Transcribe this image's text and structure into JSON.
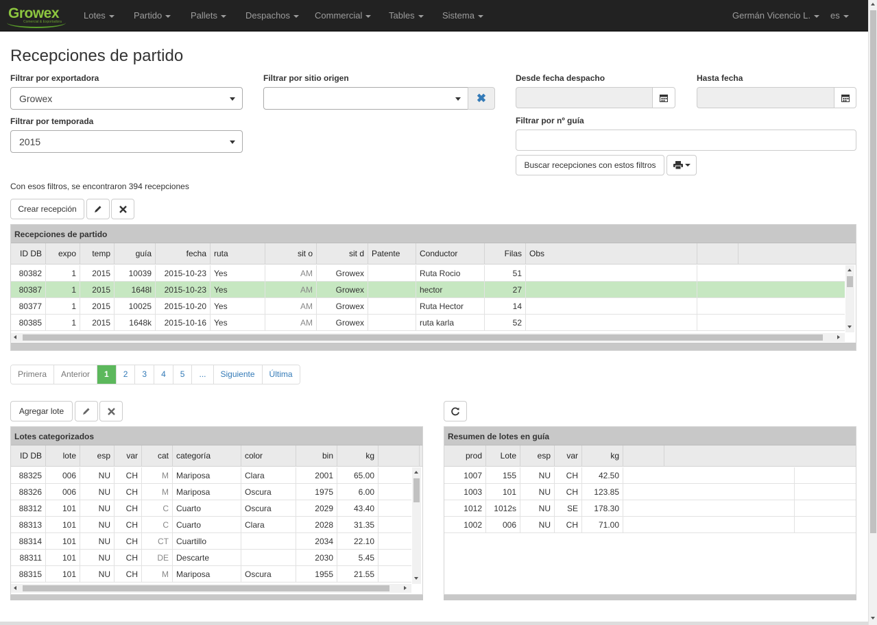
{
  "nav": {
    "brand": "Growex",
    "brand_sub": "Comercial & Exportadora",
    "menu": [
      "Lotes",
      "Partido",
      "Pallets",
      "Despachos",
      "Commercial",
      "Tables",
      "Sistema"
    ],
    "user": "Germán Vicencio L.",
    "lang": "es"
  },
  "page": {
    "title": "Recepciones de partido"
  },
  "filters": {
    "exportadora_label": "Filtrar por exportadora",
    "exportadora_value": "Growex",
    "sitio_label": "Filtrar por sitio origen",
    "sitio_value": "",
    "desde_label": "Desde fecha despacho",
    "hasta_label": "Hasta fecha",
    "temporada_label": "Filtrar por temporada",
    "temporada_value": "2015",
    "guia_label": "Filtrar por nº guía",
    "search_button": "Buscar recepciones con estos filtros"
  },
  "info": "Con esos filtros, se encontraron 394 recepciones",
  "actions": {
    "create": "Crear recepción"
  },
  "receptions": {
    "title": "Recepciones de partido",
    "columns": [
      "ID DB",
      "expo",
      "temp",
      "guía",
      "fecha",
      "ruta",
      "sit o",
      "sit d",
      "Patente",
      "Conductor",
      "Filas",
      "Obs"
    ],
    "rows": [
      [
        "80382",
        "1",
        "2015",
        "10039",
        "2015-10-23",
        "Yes",
        "AM",
        "Growex",
        "",
        "Ruta Rocio",
        "51",
        ""
      ],
      [
        "80387",
        "1",
        "2015",
        "1648l",
        "2015-10-23",
        "Yes",
        "AM",
        "Growex",
        "",
        "hector",
        "27",
        ""
      ],
      [
        "80377",
        "1",
        "2015",
        "10025",
        "2015-10-20",
        "Yes",
        "AM",
        "Growex",
        "",
        "Ruta Hector",
        "14",
        ""
      ],
      [
        "80385",
        "1",
        "2015",
        "1648k",
        "2015-10-16",
        "Yes",
        "AM",
        "Growex",
        "",
        "ruta karla",
        "52",
        ""
      ]
    ],
    "selected_row": 1
  },
  "pagination": {
    "first": "Primera",
    "prev": "Anterior",
    "pages": [
      "1",
      "2",
      "3",
      "4",
      "5",
      "..."
    ],
    "active": "1",
    "next": "Siguiente",
    "last": "Última"
  },
  "lot_actions": {
    "add": "Agregar lote"
  },
  "lots": {
    "title": "Lotes categorizados",
    "columns": [
      "ID DB",
      "lote",
      "esp",
      "var",
      "cat",
      "categoría",
      "color",
      "bin",
      "kg"
    ],
    "rows": [
      [
        "88325",
        "006",
        "NU",
        "CH",
        "M",
        "Mariposa",
        "Clara",
        "2001",
        "65.00"
      ],
      [
        "88326",
        "006",
        "NU",
        "CH",
        "M",
        "Mariposa",
        "Oscura",
        "1975",
        "6.00"
      ],
      [
        "88312",
        "101",
        "NU",
        "CH",
        "C",
        "Cuarto",
        "Oscura",
        "2029",
        "43.40"
      ],
      [
        "88313",
        "101",
        "NU",
        "CH",
        "C",
        "Cuarto",
        "Clara",
        "2028",
        "31.35"
      ],
      [
        "88314",
        "101",
        "NU",
        "CH",
        "CT",
        "Cuartillo",
        "",
        "2034",
        "22.10"
      ],
      [
        "88311",
        "101",
        "NU",
        "CH",
        "DE",
        "Descarte",
        "",
        "2030",
        "5.45"
      ],
      [
        "88315",
        "101",
        "NU",
        "CH",
        "M",
        "Mariposa",
        "Oscura",
        "1955",
        "21.55"
      ]
    ]
  },
  "summary": {
    "title": "Resumen de lotes en guía",
    "columns": [
      "prod",
      "Lote",
      "esp",
      "var",
      "kg"
    ],
    "rows": [
      [
        "1007",
        "155",
        "NU",
        "CH",
        "42.50"
      ],
      [
        "1003",
        "101",
        "NU",
        "CH",
        "123.85"
      ],
      [
        "1012",
        "1012s",
        "NU",
        "SE",
        "178.30"
      ],
      [
        "1002",
        "006",
        "NU",
        "CH",
        "71.00"
      ]
    ]
  },
  "colors": {
    "navbar": "#222222",
    "selected_row": "#c6e7c1",
    "active_page": "#5cb85c",
    "link": "#337ab7"
  }
}
